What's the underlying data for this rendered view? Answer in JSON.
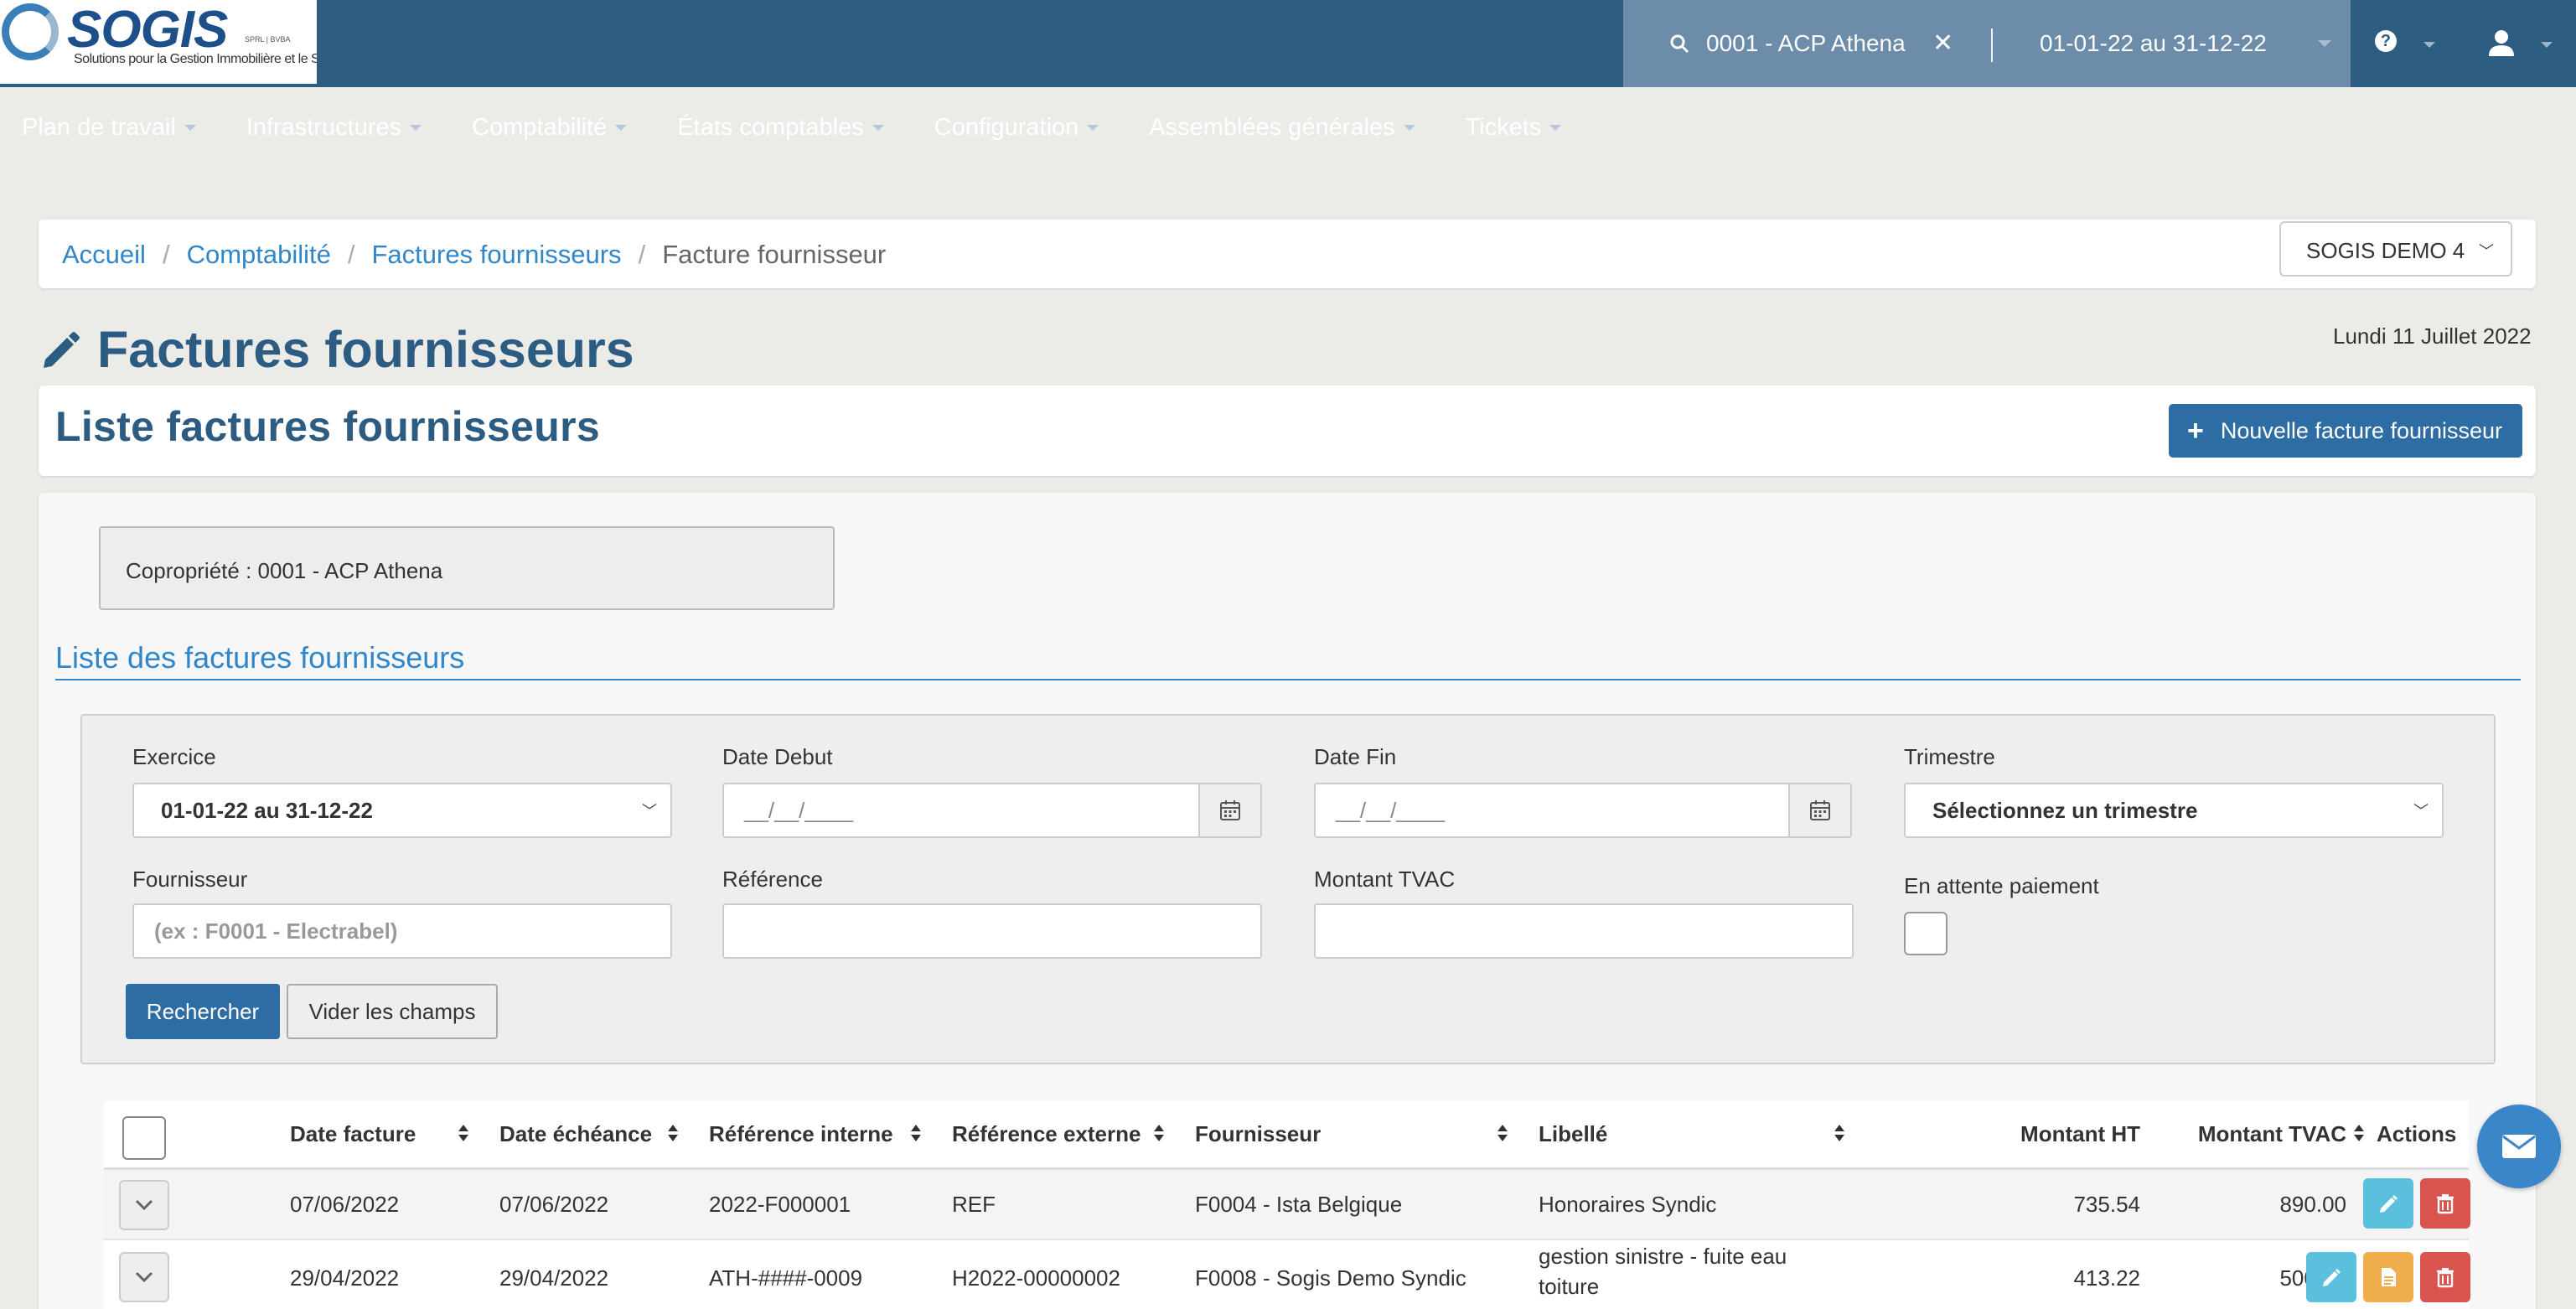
{
  "brand": {
    "name": "SOGIS",
    "legal": "SPRL | BVBA",
    "tagline": "Solutions pour la Gestion Immobilière et le Syndic"
  },
  "header": {
    "copropriete": "0001 - ACP Athena",
    "period": "01-01-22 au 31-12-22",
    "help_label": "?"
  },
  "nav": [
    {
      "label": "Plan de travail"
    },
    {
      "label": "Infrastructures"
    },
    {
      "label": "Comptabilité"
    },
    {
      "label": "États comptables"
    },
    {
      "label": "Configuration"
    },
    {
      "label": "Assemblées générales"
    },
    {
      "label": "Tickets"
    }
  ],
  "breadcrumb": {
    "items": [
      "Accueil",
      "Comptabilité",
      "Factures fournisseurs"
    ],
    "current": "Facture fournisseur",
    "separator": "/"
  },
  "agency_select": {
    "value": "SOGIS DEMO 4"
  },
  "page": {
    "title": "Factures fournisseurs",
    "date": "Lundi 11 Juillet 2022"
  },
  "list_card": {
    "title": "Liste factures fournisseurs",
    "new_button": "Nouvelle facture fournisseur",
    "new_button_icon": "+"
  },
  "copro_box": {
    "text": "Copropriété : 0001 - ACP Athena"
  },
  "section_title": "Liste des factures fournisseurs",
  "filters": {
    "exercice": {
      "label": "Exercice",
      "value": "01-01-22 au 31-12-22"
    },
    "date_debut": {
      "label": "Date Debut",
      "value": "__/__/____"
    },
    "date_fin": {
      "label": "Date Fin",
      "value": "__/__/____"
    },
    "trimestre": {
      "label": "Trimestre",
      "value": "Sélectionnez un trimestre"
    },
    "fournisseur": {
      "label": "Fournisseur",
      "placeholder": "(ex : F0001 - Electrabel)"
    },
    "reference": {
      "label": "Référence",
      "value": ""
    },
    "montant_tvac": {
      "label": "Montant TVAC",
      "value": ""
    },
    "en_attente": {
      "label": "En attente paiement",
      "checked": false
    },
    "search_button": "Rechercher",
    "clear_button": "Vider les champs"
  },
  "table": {
    "columns": [
      "Date facture",
      "Date échéance",
      "Référence interne",
      "Référence externe",
      "Fournisseur",
      "Libellé",
      "Montant HT",
      "Montant TVAC",
      "Actions"
    ],
    "rows": [
      {
        "date_facture": "07/06/2022",
        "date_echeance": "07/06/2022",
        "ref_interne": "2022-F000001",
        "ref_externe": "REF",
        "fournisseur": "F0004 - Ista Belgique",
        "libelle": "Honoraires Syndic",
        "libelle2": "",
        "montant_ht": "735.54",
        "montant_tvac": "890.00"
      },
      {
        "date_facture": "29/04/2022",
        "date_echeance": "29/04/2022",
        "ref_interne": "ATH-####-0009",
        "ref_externe": "H2022-00000002",
        "fournisseur": "F0008 - Sogis Demo Syndic",
        "libelle": "gestion sinistre - fuite eau",
        "libelle2": "toiture",
        "montant_ht": "413.22",
        "montant_tvac": "500.00"
      }
    ]
  },
  "colors": {
    "header_bg": "#2e5d82",
    "context_panel": "#6d8ca9",
    "primary": "#2e6da4",
    "link": "#2f86c9",
    "edit_btn": "#5bc0de",
    "doc_btn": "#f0ad4e",
    "delete_btn": "#d9534f"
  }
}
